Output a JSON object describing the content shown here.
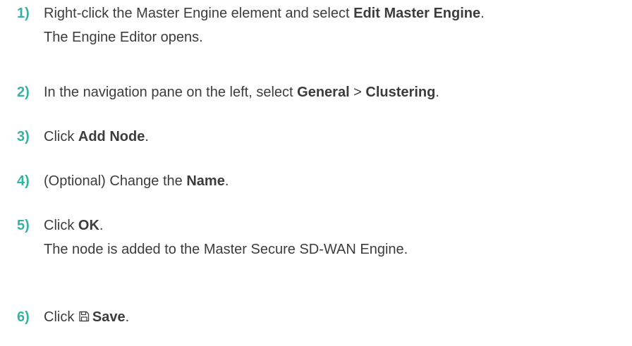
{
  "steps": [
    {
      "number": "1)",
      "before": "Right-click the Master Engine element and select ",
      "bold": "Edit Master Engine",
      "after": ".",
      "result": "The Engine Editor opens."
    },
    {
      "number": "2)",
      "before": "In the navigation pane on the left, select ",
      "bold1": "General",
      "sep": " > ",
      "bold2": "Clustering",
      "after": "."
    },
    {
      "number": "3)",
      "before": "Click ",
      "bold": "Add Node",
      "after": "."
    },
    {
      "number": "4)",
      "before": "(Optional) Change the ",
      "bold": "Name",
      "after": "."
    },
    {
      "number": "5)",
      "before": "Click ",
      "bold": "OK",
      "after": ".",
      "result": "The node is added to the Master Secure SD-WAN Engine."
    },
    {
      "number": "6)",
      "before": "Click ",
      "icon": "save-icon",
      "bold": "Save",
      "after": "."
    }
  ],
  "colors": {
    "step_number": "#35b2a4",
    "text": "#3c3c3c"
  }
}
